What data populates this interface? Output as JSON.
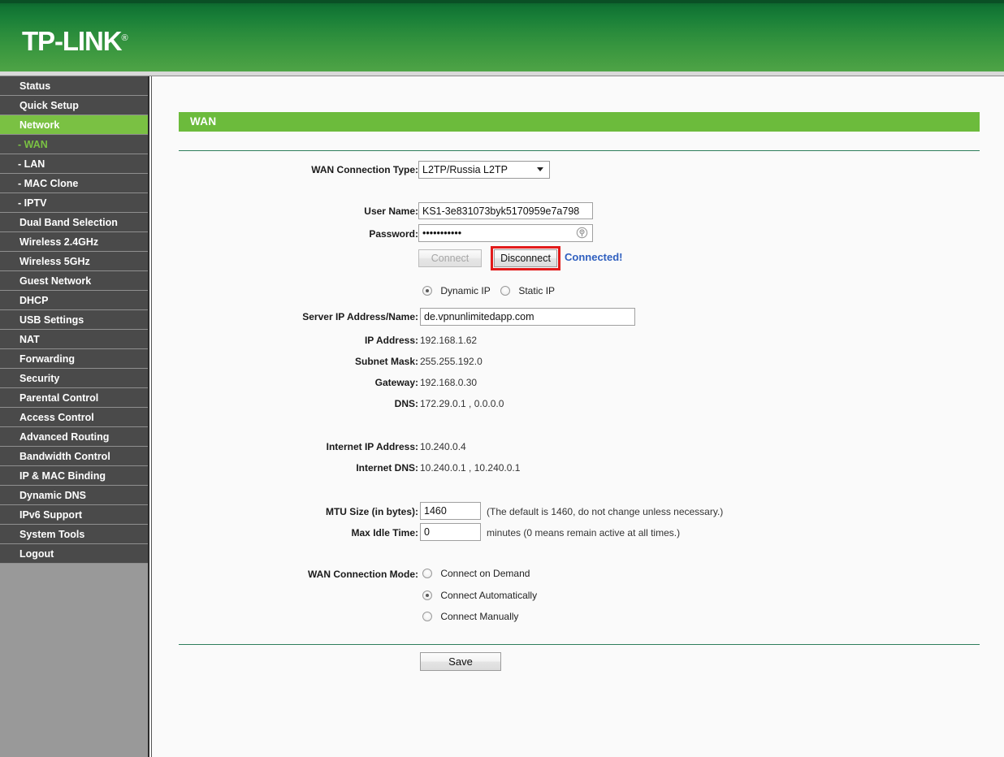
{
  "header": {
    "brand": "TP-LINK",
    "brand_mark": "®",
    "brand_color": "#1a8038"
  },
  "sidebar": {
    "items": [
      {
        "label": "Status",
        "type": "main",
        "state": "normal"
      },
      {
        "label": "Quick Setup",
        "type": "main",
        "state": "normal"
      },
      {
        "label": "Network",
        "type": "main",
        "state": "active"
      },
      {
        "label": "- WAN",
        "type": "sub",
        "state": "current"
      },
      {
        "label": "- LAN",
        "type": "sub",
        "state": "normal"
      },
      {
        "label": "- MAC Clone",
        "type": "sub",
        "state": "normal"
      },
      {
        "label": "- IPTV",
        "type": "sub",
        "state": "normal"
      },
      {
        "label": "Dual Band Selection",
        "type": "main",
        "state": "normal"
      },
      {
        "label": "Wireless 2.4GHz",
        "type": "main",
        "state": "normal"
      },
      {
        "label": "Wireless 5GHz",
        "type": "main",
        "state": "normal"
      },
      {
        "label": "Guest Network",
        "type": "main",
        "state": "normal"
      },
      {
        "label": "DHCP",
        "type": "main",
        "state": "normal"
      },
      {
        "label": "USB Settings",
        "type": "main",
        "state": "normal"
      },
      {
        "label": "NAT",
        "type": "main",
        "state": "normal"
      },
      {
        "label": "Forwarding",
        "type": "main",
        "state": "normal"
      },
      {
        "label": "Security",
        "type": "main",
        "state": "normal"
      },
      {
        "label": "Parental Control",
        "type": "main",
        "state": "normal"
      },
      {
        "label": "Access Control",
        "type": "main",
        "state": "normal"
      },
      {
        "label": "Advanced Routing",
        "type": "main",
        "state": "normal"
      },
      {
        "label": "Bandwidth Control",
        "type": "main",
        "state": "normal"
      },
      {
        "label": "IP & MAC Binding",
        "type": "main",
        "state": "normal"
      },
      {
        "label": "Dynamic DNS",
        "type": "main",
        "state": "normal"
      },
      {
        "label": "IPv6 Support",
        "type": "main",
        "state": "normal"
      },
      {
        "label": "System Tools",
        "type": "main",
        "state": "normal"
      },
      {
        "label": "Logout",
        "type": "main",
        "state": "normal"
      }
    ]
  },
  "page": {
    "title": "WAN",
    "title_bar_color": "#6cbb3c"
  },
  "form": {
    "connection_type_label": "WAN Connection Type:",
    "connection_type_value": "L2TP/Russia L2TP",
    "connection_type_options": [
      "L2TP/Russia L2TP"
    ],
    "username_label": "User Name:",
    "username_value": "KS1-3e831073byk5170959e7a798",
    "password_label": "Password:",
    "password_masked": "•••••••••••",
    "password_reveal_icon": "eye-reveal-icon",
    "connect_label": "Connect",
    "disconnect_label": "Disconnect",
    "status_text": "Connected!",
    "status_color": "#2f5fbf",
    "highlight_color": "#e21b1b",
    "ip_mode_dynamic_label": "Dynamic IP",
    "ip_mode_static_label": "Static IP",
    "ip_mode_selected": "Dynamic IP",
    "server_label": "Server IP Address/Name:",
    "server_value": "de.vpnunlimitedapp.com",
    "ip_address_label": "IP Address:",
    "ip_address_value": "192.168.1.62",
    "subnet_mask_label": "Subnet Mask:",
    "subnet_mask_value": "255.255.192.0",
    "gateway_label": "Gateway:",
    "gateway_value": "192.168.0.30",
    "dns_label": "DNS:",
    "dns_value": "172.29.0.1 , 0.0.0.0",
    "internet_ip_label": "Internet IP Address:",
    "internet_ip_value": "10.240.0.4",
    "internet_dns_label": "Internet DNS:",
    "internet_dns_value": "10.240.0.1 , 10.240.0.1",
    "mtu_label": "MTU Size (in bytes):",
    "mtu_value": "1460",
    "mtu_hint": "(The default is 1460, do not change unless necessary.)",
    "idle_label": "Max Idle Time:",
    "idle_value": "0",
    "idle_hint": "minutes (0 means remain active at all times.)",
    "mode_label": "WAN Connection Mode:",
    "mode_on_demand": "Connect on Demand",
    "mode_automatically": "Connect Automatically",
    "mode_manually": "Connect Manually",
    "mode_selected": "Connect Automatically",
    "save_label": "Save"
  }
}
